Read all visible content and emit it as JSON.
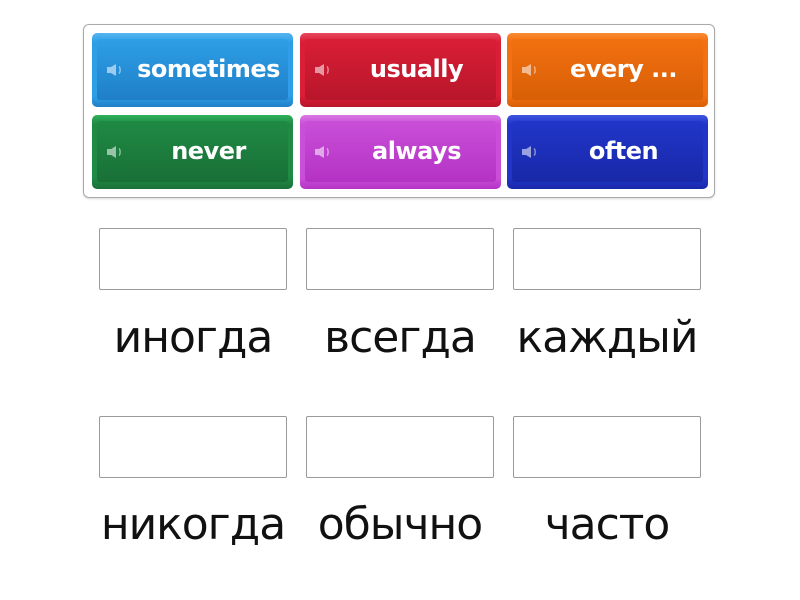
{
  "tiles": [
    {
      "label": "sometimes",
      "color": "#2e9fe6",
      "dark": "#1f7fc8",
      "light": "#55b5f0",
      "speaker_icon": "speaker-icon"
    },
    {
      "label": "usually",
      "color": "#d91e36",
      "dark": "#b8162b",
      "light": "#e8485d",
      "speaker_icon": "speaker-icon"
    },
    {
      "label": "every ...",
      "color": "#f27010",
      "dark": "#d85f06",
      "light": "#fb8b33",
      "speaker_icon": "speaker-icon"
    },
    {
      "label": "never",
      "color": "#1f8a44",
      "dark": "#197037",
      "light": "#2fb35a",
      "speaker_icon": "speaker-icon"
    },
    {
      "label": "always",
      "color": "#c94fd8",
      "dark": "#b432c4",
      "light": "#d97ae4",
      "speaker_icon": "speaker-icon"
    },
    {
      "label": "often",
      "color": "#2136c9",
      "dark": "#1828a8",
      "light": "#3f55e0",
      "speaker_icon": "speaker-icon"
    }
  ],
  "targets": [
    {
      "label": "иногда",
      "answer": ""
    },
    {
      "label": "всегда",
      "answer": ""
    },
    {
      "label": "каждый",
      "answer": ""
    },
    {
      "label": "никогда",
      "answer": ""
    },
    {
      "label": "обычно",
      "answer": ""
    },
    {
      "label": "часто",
      "answer": ""
    }
  ]
}
